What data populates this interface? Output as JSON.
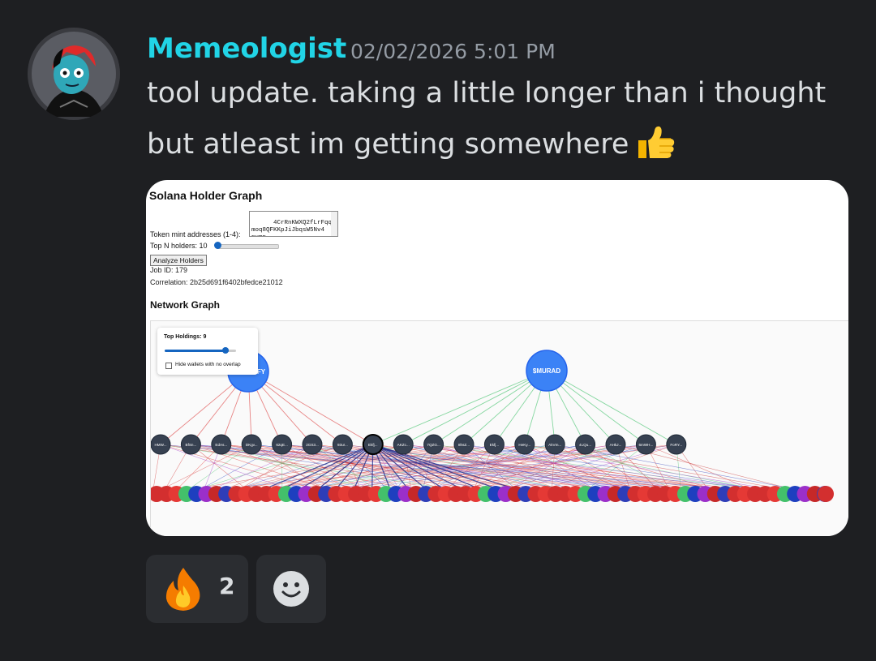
{
  "message": {
    "username": "Memeologist",
    "timestamp": "02/02/2026 5:01 PM",
    "text_line1": "tool update. taking a little longer than i thought",
    "text_line2": "but atleast im getting somewhere",
    "emoji": "thumbs-up",
    "colors": {
      "username": "#21d4e6",
      "background": "#1e1f22",
      "text": "#dbdee1",
      "timestamp": "#949ba4"
    }
  },
  "attachment": {
    "title": "Solana Holder Graph",
    "mint_label": "Token mint addresses (1-4):",
    "mint_value": "4CrRnKWXQ2fLrFqqHvnq\nmoq8QFKKpJiJbqsW5Nv4\npump",
    "topn_label": "Top N holders: 10",
    "topn_value": 10,
    "analyze_button": "Analyze Holders",
    "job_id": "Job ID: 179",
    "correlation": "Correlation: 2b25d691f6402bfedce21012",
    "network_title": "Network Graph",
    "control_panel": {
      "label": "Top Holdings: 9",
      "holdings_value": 9,
      "hide_label": "Hide wallets with no overlap",
      "hide_checked": false
    },
    "graph": {
      "tokens": [
        {
          "label": "FY",
          "color": "#3b82f6"
        },
        {
          "label": "$MURAD",
          "color": "#3b82f6"
        }
      ],
      "holders": [
        "HMW...",
        "BfSn...",
        "EdAs...",
        "DKgv...",
        "62qE...",
        "2GS3...",
        "93ur...",
        "Ekfj...",
        "AKZc...",
        "7QZG...",
        "8hsZ...",
        "Ekfj...",
        "HeKy...",
        "AkVm...",
        "4LQu...",
        "AHkJ...",
        "6mWH...",
        "FoRY..."
      ],
      "edge_colors": [
        "#e05555",
        "#55c87a",
        "#4a5bd8",
        "#c24fd6",
        "#1f2a8a"
      ],
      "leaf_colors": [
        "#d32f2f",
        "#d32f2f",
        "#e53935",
        "#43c06b",
        "#1e3fbf",
        "#9b2fc9",
        "#c62828",
        "#2e3db8",
        "#d32f2f",
        "#e53935"
      ]
    }
  },
  "reactions": [
    {
      "emoji": "fire",
      "count": "2"
    }
  ],
  "add_reaction": {
    "icon": "smiley-add-icon"
  }
}
